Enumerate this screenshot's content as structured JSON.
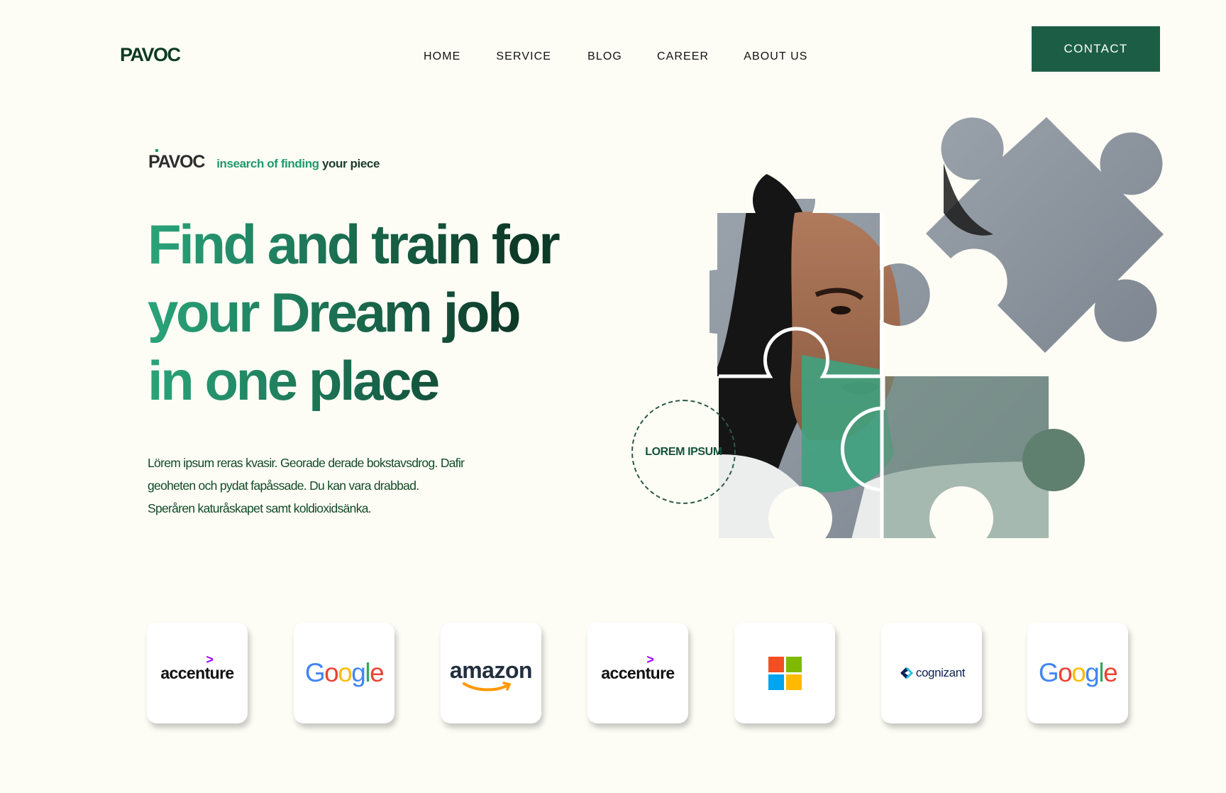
{
  "header": {
    "logo": "PAVOC",
    "nav": [
      "HOME",
      "SERVICE",
      "BLOG",
      "CAREER",
      "ABOUT US"
    ],
    "contact": "CONTACT"
  },
  "hero": {
    "brand": "PAVOC",
    "tagline_green": "insearch of finding",
    "tagline_dark": "your piece",
    "headline": [
      "Find and train for",
      "your Dream job",
      "in one place"
    ],
    "description": [
      "Lörem ipsum reras kvasir. Georade derade bokstavsdrog. Dafir",
      "geoheten och pydat fapåssade. Du kan vara drabbad.",
      "Speråren katuråskapet samt koldioxidsänka."
    ],
    "badge": "LOREM IPSUM"
  },
  "logos": {
    "accenture_1": "accenture",
    "google_1": "Google",
    "amazon": "amazon",
    "accenture_2": "accenture",
    "microsoft_icon": "microsoft-logo-icon",
    "cognizant": "cognizant",
    "google_2": "Google"
  },
  "colors": {
    "accent": "#1b5e45",
    "background": "#fdfdf6",
    "green_light": "#2aa47a",
    "green_dark": "#0e3a29"
  }
}
